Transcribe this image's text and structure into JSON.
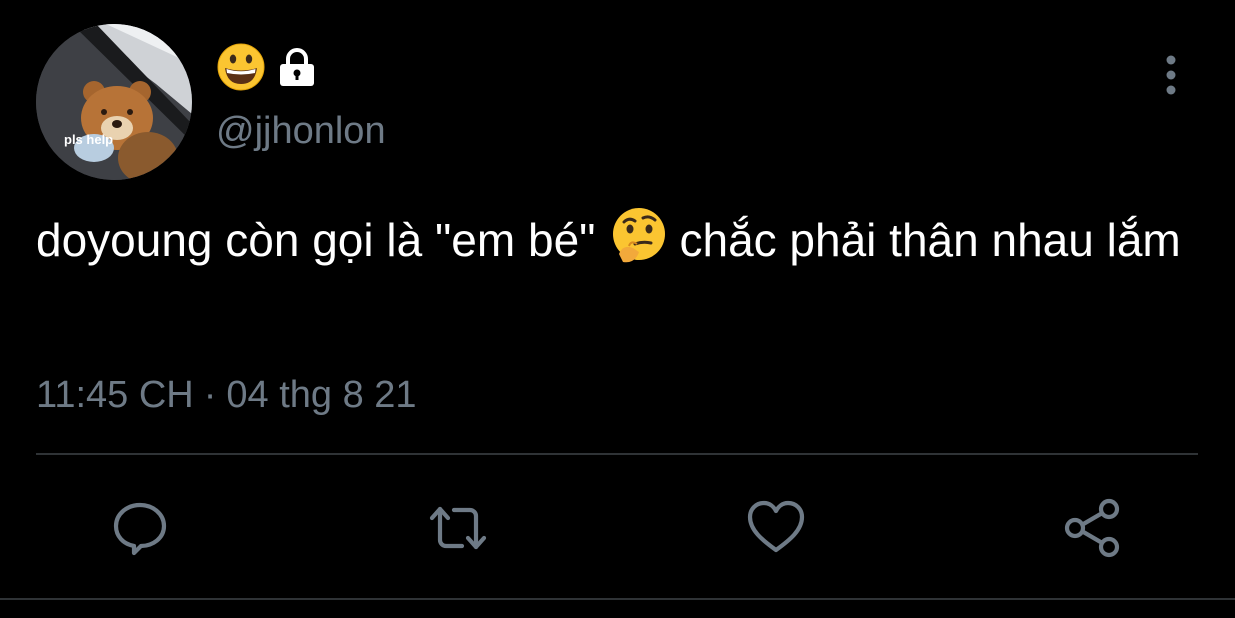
{
  "tweet": {
    "avatar_caption": "pls help",
    "display_name_emojis": "😀",
    "handle": "@jjhonlon",
    "text_part1": "doyoung còn gọi là \"em bé\"",
    "text_emoji": "🤔",
    "text_part2": "chắc phải thân nhau lắm",
    "time": "11:45 CH",
    "separator": "·",
    "date": "04 thg 8 21"
  },
  "icons": {
    "lock": "lock-icon",
    "more": "more-vertical-icon",
    "reply": "reply-icon",
    "retweet": "retweet-icon",
    "like": "heart-icon",
    "share": "share-icon"
  },
  "colors": {
    "background": "#000000",
    "text": "#ffffff",
    "secondary": "#6e7a86",
    "divider": "#2f3336"
  }
}
